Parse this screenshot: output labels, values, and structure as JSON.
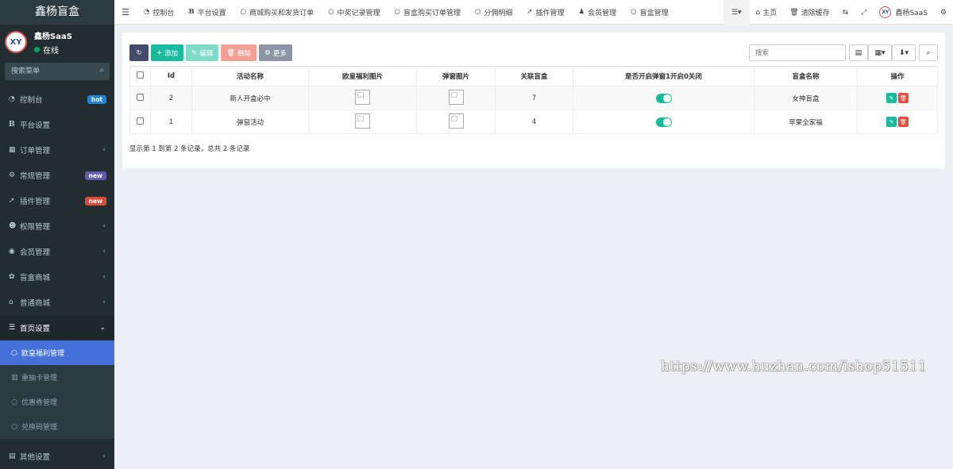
{
  "app": {
    "title": "鑫杨盲盒",
    "user_name": "鑫杨SaaS",
    "user_status": "在线",
    "search_placeholder": "搜索菜单"
  },
  "sidebar": {
    "items": [
      {
        "label": "控制台",
        "icon": "dashboard-icon",
        "badge": "hot",
        "badge_color": "#1f84d3"
      },
      {
        "label": "平台设置",
        "icon": "bold-b-icon"
      },
      {
        "label": "订单管理",
        "icon": "calculator-icon",
        "chevron": "‹"
      },
      {
        "label": "常规管理",
        "icon": "cogs-icon",
        "badge": "new",
        "badge_color": "#605ca8"
      },
      {
        "label": "插件管理",
        "icon": "rocket-icon",
        "badge": "new",
        "badge_color": "#dd4b39"
      },
      {
        "label": "权限管理",
        "icon": "group-icon",
        "chevron": "‹"
      },
      {
        "label": "会员管理",
        "icon": "user-circle-icon",
        "chevron": "‹"
      },
      {
        "label": "盲盒商城",
        "icon": "gift-icon",
        "chevron": "‹"
      },
      {
        "label": "普通商城",
        "icon": "bank-icon",
        "chevron": "‹"
      },
      {
        "label": "首页设置",
        "icon": "list-icon",
        "chevron": "⌄"
      }
    ],
    "sub_items": [
      {
        "label": "欧皇福利管理",
        "active": true
      },
      {
        "label": "重抽卡管理",
        "icon": "chart-icon"
      },
      {
        "label": "优惠券管理"
      },
      {
        "label": "兑换码管理"
      }
    ],
    "bottom_item": {
      "label": "其他设置",
      "chevron": "‹"
    }
  },
  "topbar": {
    "tabs": [
      "控制台",
      "平台设置",
      "商城购买和发货订单",
      "中奖记录管理",
      "盲盒购买订单管理",
      "分佣明细",
      "插件管理",
      "会员管理",
      "盲盒管理"
    ],
    "home": "主页",
    "clear_cache": "清除缓存",
    "user": "鑫杨SaaS"
  },
  "toolbar": {
    "add": "添加",
    "edit": "编辑",
    "delete": "删除",
    "more": "更多",
    "search_placeholder": "搜索"
  },
  "table": {
    "headers": [
      "Id",
      "活动名称",
      "欧皇福利图片",
      "弹窗图片",
      "关联盲盒",
      "是否开启弹窗1开启0关闭",
      "盲盒名称",
      "操作"
    ],
    "rows": [
      {
        "id": "2",
        "name": "新人开盒必中",
        "box_count": "7",
        "popup_on": true,
        "box_name": "女神盲盒"
      },
      {
        "id": "1",
        "name": "弹窗活动",
        "box_count": "4",
        "popup_on": true,
        "box_name": "苹果全家福"
      }
    ],
    "summary": "显示第 1 到第 2 条记录，总共 2 条记录"
  },
  "watermark": "https://www.huzhan.com/ishop51511"
}
